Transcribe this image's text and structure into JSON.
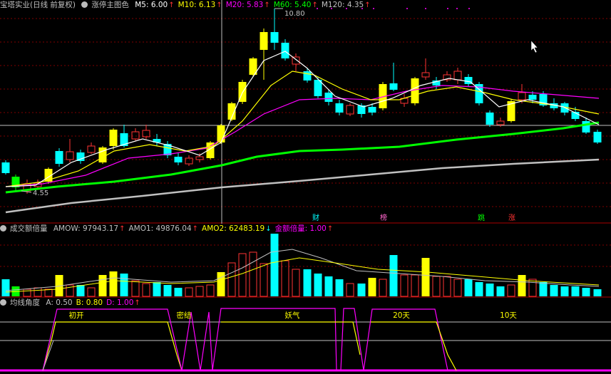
{
  "main": {
    "title": "宝塔实业(日线 前复权)",
    "indicator_name": "涨停主图色",
    "ma": [
      {
        "label": "M5: 6.00",
        "color": "#ffffff",
        "arrow": "↑",
        "arrow_color": "#ff3333"
      },
      {
        "label": "M10: 6.13",
        "color": "#ffff00",
        "arrow": "↑",
        "arrow_color": "#ff3333"
      },
      {
        "label": "M20: 5.83",
        "color": "#ff00ff",
        "arrow": "↑",
        "arrow_color": "#ff3333"
      },
      {
        "label": "M60: 5.40",
        "color": "#00ff00",
        "arrow": "↑",
        "arrow_color": "#ff3333"
      },
      {
        "label": "M120: 4.35",
        "color": "#c0c0c0",
        "arrow": "↑",
        "arrow_color": "#ff3333"
      }
    ],
    "high_label": "10.80",
    "low_label": "4.55",
    "markers": [
      {
        "text": "财",
        "color": "#00ffff"
      },
      {
        "text": "榜",
        "color": "#ff66cc"
      },
      {
        "text": "跳",
        "color": "#00ff00"
      },
      {
        "text": "涨",
        "color": "#ff3333"
      }
    ]
  },
  "volume": {
    "title": "成交额倍量",
    "items": [
      {
        "label": "AMOW: 97943.17",
        "color": "#c0c0c0",
        "arrow": "↑",
        "arrow_color": "#ff3333"
      },
      {
        "label": "AMO1: 49876.04",
        "color": "#c0c0c0",
        "arrow": "↑",
        "arrow_color": "#ff3333"
      },
      {
        "label": "AMO2: 62483.19",
        "color": "#ffff00",
        "arrow": "↓",
        "arrow_color": "#00ffff"
      },
      {
        "label": "金额倍量: 1.00",
        "color": "#ff00ff",
        "arrow": "↑",
        "arrow_color": "#ff3333"
      }
    ]
  },
  "angle": {
    "title": "均线角度",
    "items": [
      {
        "label": "A: 0.50",
        "color": "#c0c0c0"
      },
      {
        "label": "B: 0.80",
        "color": "#ffff00"
      },
      {
        "label": "D: 1.00",
        "color": "#ff00ff",
        "arrow": "↑",
        "arrow_color": "#ff3333"
      }
    ],
    "zones": [
      "初开",
      "密结",
      "妖气",
      "20天",
      "10天"
    ]
  },
  "colors": {
    "up": "#ff3333",
    "down": "#00ffff",
    "limit_up": "#ffff00",
    "ma5": "#ffffff",
    "ma10": "#ffff00",
    "ma20": "#ff00ff",
    "ma60": "#00ff00",
    "ma120": "#c0c0c0",
    "grid": "#800000"
  }
}
